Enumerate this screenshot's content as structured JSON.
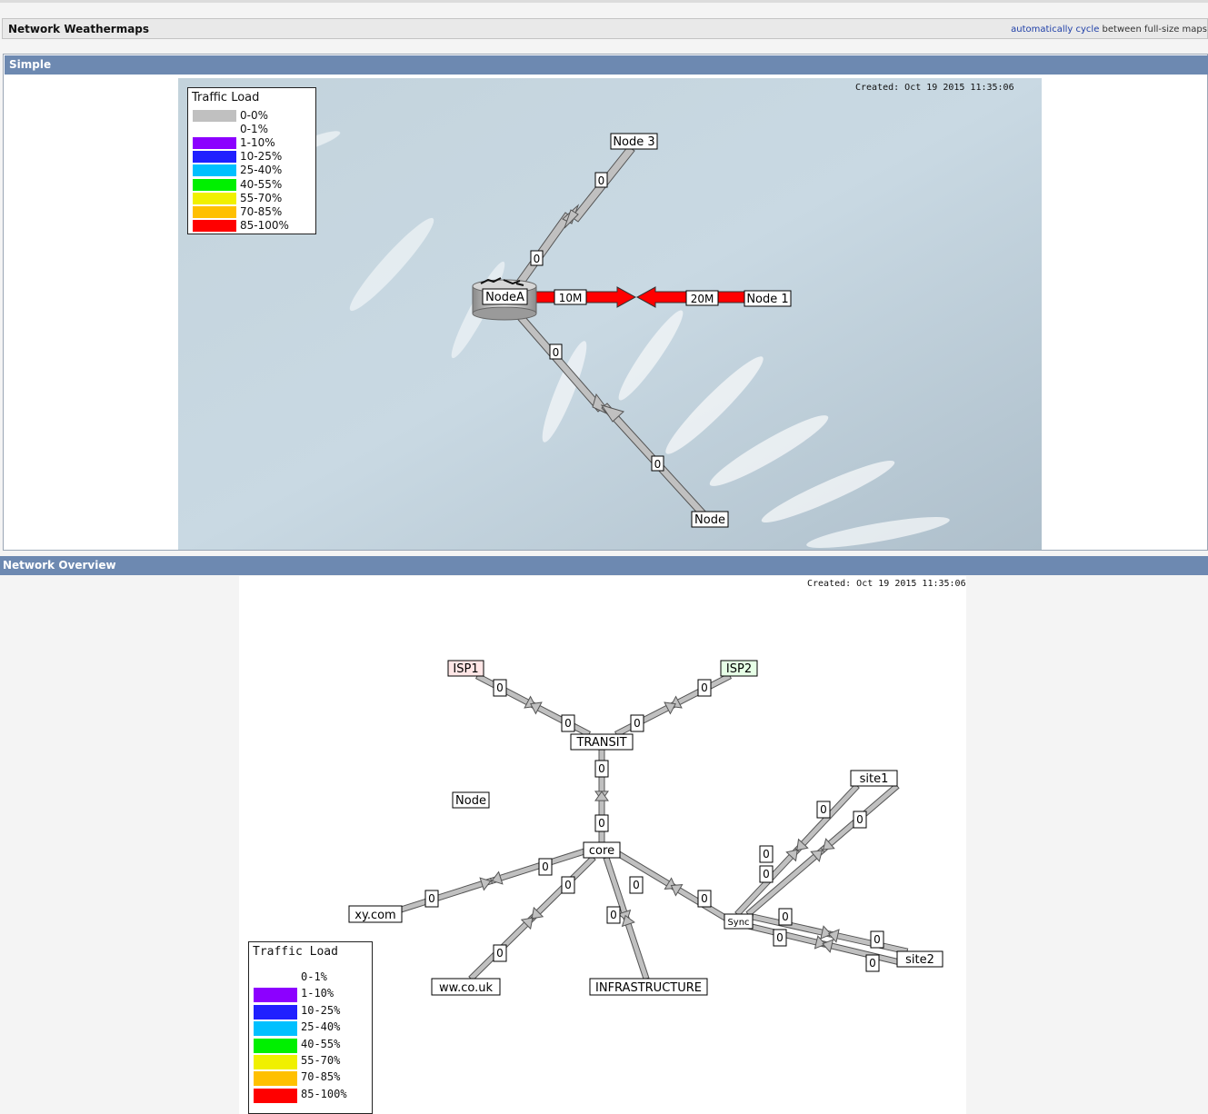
{
  "page": {
    "title": "Network Weathermaps"
  },
  "cycle": {
    "link1": "automatically",
    "link2": "cycle",
    "rest": "between full-size maps"
  },
  "map1": {
    "section_title": "Simple",
    "created": "Created: Oct 19 2015 11:35:06",
    "legend": {
      "title": "Traffic Load",
      "items": [
        {
          "label": "0-0%",
          "color": "#c0c0c0"
        },
        {
          "label": "0-1%",
          "color": "#ffffff"
        },
        {
          "label": "1-10%",
          "color": "#8c00ff"
        },
        {
          "label": "10-25%",
          "color": "#2020ff"
        },
        {
          "label": "25-40%",
          "color": "#00c0ff"
        },
        {
          "label": "40-55%",
          "color": "#00f000"
        },
        {
          "label": "55-70%",
          "color": "#f0f000"
        },
        {
          "label": "70-85%",
          "color": "#ffc000"
        },
        {
          "label": "85-100%",
          "color": "#ff0000"
        }
      ]
    },
    "nodes": {
      "nodeA": "NodeA",
      "node1": "Node 1",
      "node3": "Node 3",
      "node": "Node"
    },
    "links": {
      "a_node1_out": "10M",
      "a_node1_in": "20M",
      "a_node3_out": "0",
      "a_node3_in": "0",
      "a_node_out": "0",
      "a_node_in": "0"
    }
  },
  "map2": {
    "section_title": "Network Overview",
    "created": "Created: Oct 19 2015 11:35:06",
    "legend": {
      "title": "Traffic Load",
      "items": [
        {
          "label": "0-1%",
          "color": "#ffffff"
        },
        {
          "label": "1-10%",
          "color": "#8c00ff"
        },
        {
          "label": "10-25%",
          "color": "#2020ff"
        },
        {
          "label": "25-40%",
          "color": "#00c0ff"
        },
        {
          "label": "40-55%",
          "color": "#00f000"
        },
        {
          "label": "55-70%",
          "color": "#f0f000"
        },
        {
          "label": "70-85%",
          "color": "#ffc000"
        },
        {
          "label": "85-100%",
          "color": "#ff0000"
        }
      ]
    },
    "nodes": {
      "isp1": "ISP1",
      "isp2": "ISP2",
      "transit": "TRANSIT",
      "node": "Node",
      "core": "core",
      "site1": "site1",
      "site2": "site2",
      "sync": "Sync",
      "xy": "xy.com",
      "ww": "ww.co.uk",
      "infra": "INFRASTRUCTURE"
    },
    "link_value": "0"
  },
  "colors": {
    "link_grey": "#c0c0c0",
    "link_hot": "#ff0000",
    "header_blue": "#6d89b1",
    "isp1_bg": "#ffe6e6",
    "isp2_bg": "#e6ffe6"
  }
}
